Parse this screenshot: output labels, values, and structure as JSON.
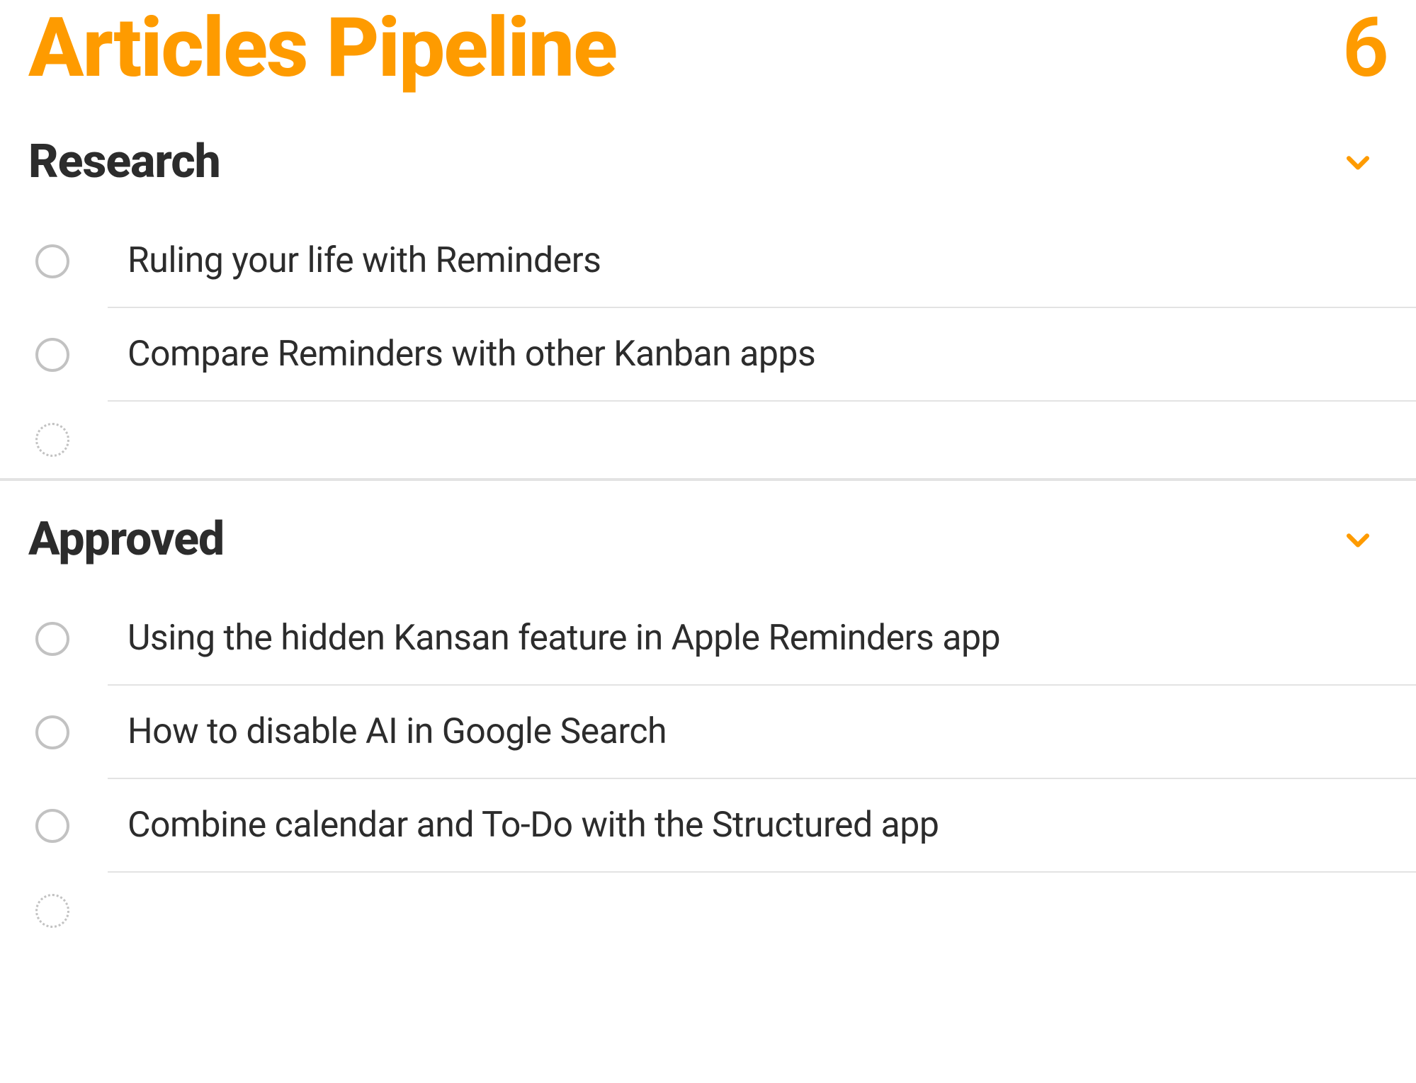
{
  "list": {
    "title": "Articles Pipeline",
    "count": "6",
    "accent_color": "#fe9b00"
  },
  "sections": [
    {
      "title": "Research",
      "items": [
        {
          "title": "Ruling your life with Reminders"
        },
        {
          "title": "Compare Reminders with other Kanban apps"
        }
      ]
    },
    {
      "title": "Approved",
      "items": [
        {
          "title": "Using the hidden Kansan feature in Apple Reminders app"
        },
        {
          "title": "How to disable AI in Google Search"
        },
        {
          "title": "Combine calendar and To-Do with the Structured app"
        }
      ]
    }
  ]
}
